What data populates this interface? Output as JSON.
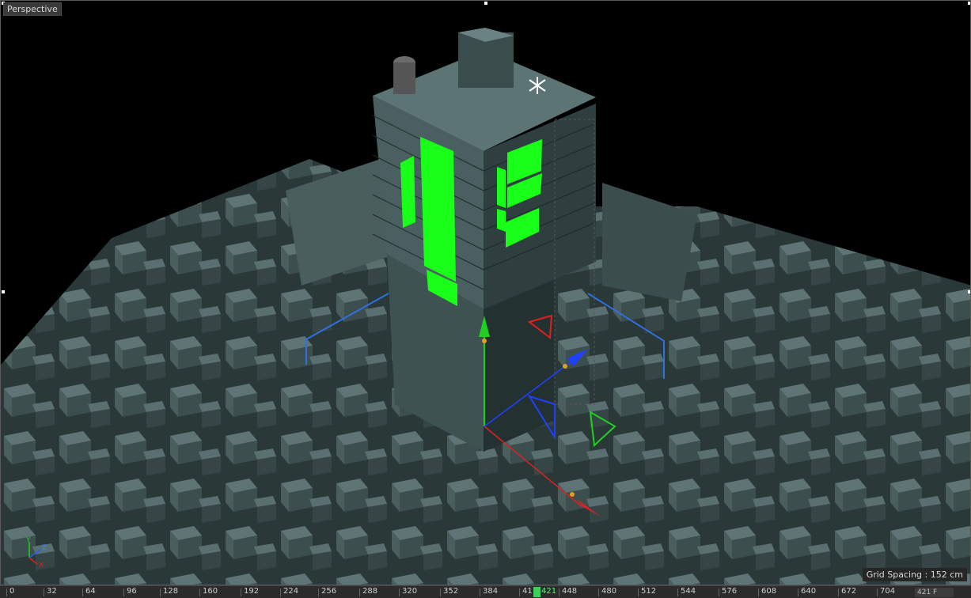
{
  "viewport": {
    "camera_label": "Perspective",
    "grid_spacing": "Grid Spacing : 152 cm",
    "axis_labels": {
      "y": "Y",
      "z": "Z",
      "x": "X"
    }
  },
  "timeline": {
    "ticks": [
      "0",
      "32",
      "64",
      "96",
      "128",
      "160",
      "192",
      "224",
      "256",
      "288",
      "320",
      "352",
      "384",
      "41",
      "448",
      "480",
      "512",
      "544",
      "576",
      "608",
      "640",
      "672",
      "704"
    ],
    "current_frame": "421",
    "frame_field": "421 F"
  },
  "colors": {
    "building": "#3a4b4b",
    "highlight": "#1aff1a",
    "axis_x": "#e02020",
    "axis_y": "#20d020",
    "axis_z": "#2040ff",
    "bbox": "#3070e0"
  }
}
